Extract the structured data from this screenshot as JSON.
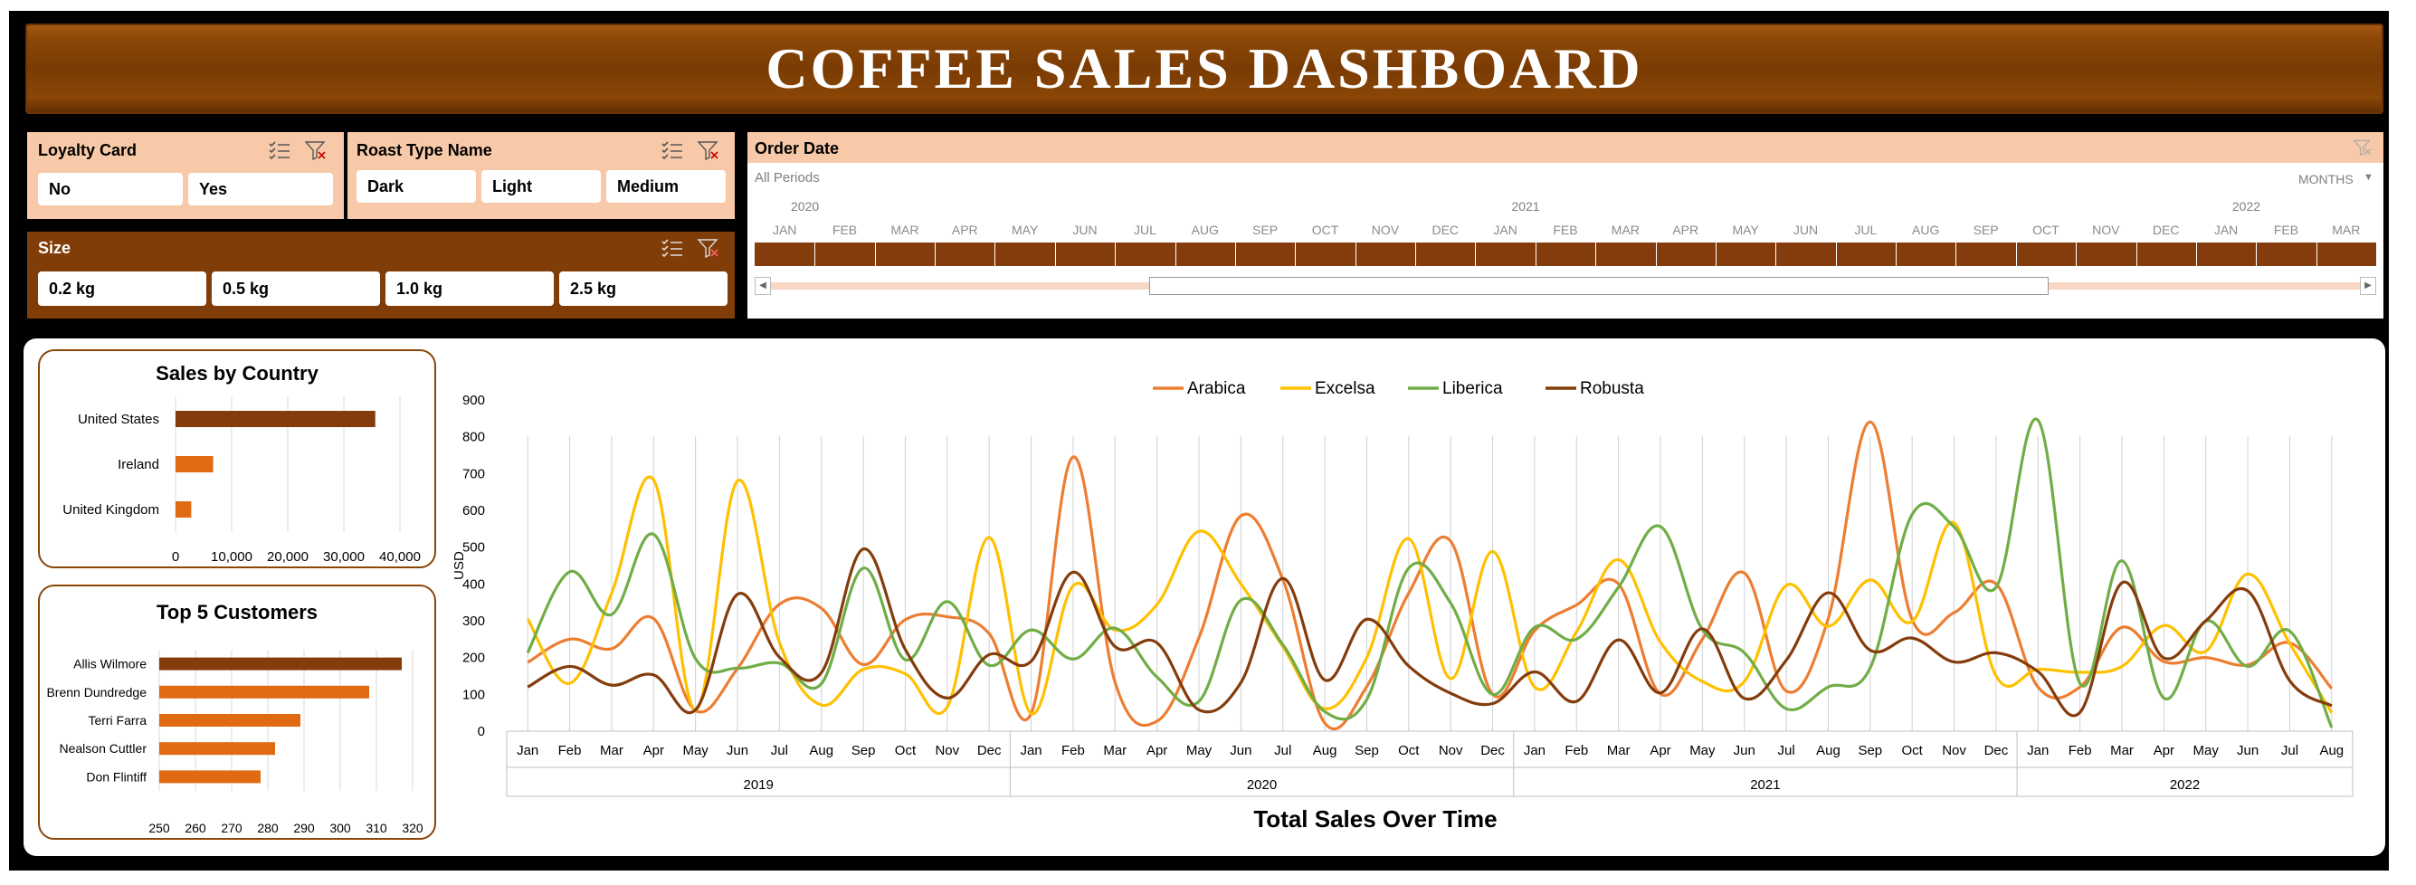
{
  "header": {
    "title": "COFFEE SALES DASHBOARD"
  },
  "slicers": {
    "loyalty": {
      "title": "Loyalty Card",
      "items": [
        "No",
        "Yes"
      ]
    },
    "roast": {
      "title": "Roast Type Name",
      "items": [
        "Dark",
        "Light",
        "Medium"
      ]
    },
    "size": {
      "title": "Size",
      "items": [
        "0.2 kg",
        "0.5 kg",
        "1.0 kg",
        "2.5 kg"
      ]
    }
  },
  "timeline": {
    "title": "Order Date",
    "period_label": "All Periods",
    "level": "MONTHS",
    "years": [
      "2020",
      "2021",
      "2022"
    ],
    "months": [
      "JAN",
      "FEB",
      "MAR",
      "APR",
      "MAY",
      "JUN",
      "JUL",
      "AUG",
      "SEP",
      "OCT",
      "NOV",
      "DEC",
      "JAN",
      "FEB",
      "MAR",
      "APR",
      "MAY",
      "JUN",
      "JUL",
      "AUG",
      "SEP",
      "OCT",
      "NOV",
      "DEC",
      "JAN",
      "FEB",
      "MAR"
    ]
  },
  "chart_data": [
    {
      "type": "bar",
      "orientation": "horizontal",
      "title": "Sales by Country",
      "categories": [
        "United States",
        "Ireland",
        "United Kingdom"
      ],
      "values": [
        35600,
        6700,
        2800
      ],
      "xlim": [
        0,
        40000
      ],
      "xticks": [
        "0",
        "10,000",
        "20,000",
        "30,000",
        "40,000"
      ],
      "colors": {
        "bar_top": "#843c0c",
        "bar": "#e06a12"
      }
    },
    {
      "type": "bar",
      "orientation": "horizontal",
      "title": "Top 5 Customers",
      "categories": [
        "Allis Wilmore",
        "Brenn Dundredge",
        "Terri Farra",
        "Nealson Cuttler",
        "Don Flintiff"
      ],
      "values": [
        317,
        308,
        289,
        282,
        278
      ],
      "xlim": [
        250,
        320
      ],
      "xticks": [
        "250",
        "260",
        "270",
        "280",
        "290",
        "300",
        "310",
        "320"
      ],
      "colors": {
        "bar_top": "#843c0c",
        "bar": "#e06a12"
      }
    },
    {
      "type": "line",
      "title": "Total Sales Over Time",
      "ylabel": "USD",
      "ylim": [
        0,
        900
      ],
      "yticks": [
        "0",
        "100",
        "200",
        "300",
        "400",
        "500",
        "600",
        "700",
        "800",
        "900"
      ],
      "x": [
        "Jan",
        "Feb",
        "Mar",
        "Apr",
        "May",
        "Jun",
        "Jul",
        "Aug",
        "Sep",
        "Oct",
        "Nov",
        "Dec",
        "Jan",
        "Feb",
        "Mar",
        "Apr",
        "May",
        "Jun",
        "Jul",
        "Aug",
        "Sep",
        "Oct",
        "Nov",
        "Dec",
        "Jan",
        "Feb",
        "Mar",
        "Apr",
        "May",
        "Jun",
        "Jul",
        "Aug",
        "Sep",
        "Oct",
        "Nov",
        "Dec",
        "Jan",
        "Feb",
        "Mar",
        "Apr",
        "May",
        "Jun",
        "Jul",
        "Aug"
      ],
      "x_groups": [
        {
          "label": "2019",
          "count": 12
        },
        {
          "label": "2020",
          "count": 12
        },
        {
          "label": "2021",
          "count": 12
        },
        {
          "label": "2022",
          "count": 8
        }
      ],
      "legend_position": "top",
      "series": [
        {
          "name": "Arabica",
          "color": "#ed7d31",
          "values": [
            187,
            250,
            224,
            306,
            56,
            170,
            345,
            334,
            181,
            303,
            311,
            265,
            48,
            745,
            133,
            27,
            254,
            585,
            412,
            22,
            121,
            375,
            516,
            100,
            273,
            343,
            400,
            101,
            250,
            430,
            109,
            306,
            840,
            303,
            322,
            400,
            120,
            120,
            282,
            189,
            200,
            180,
            240,
            116
          ]
        },
        {
          "name": "Excelsa",
          "color": "#ffc000",
          "values": [
            305,
            130,
            375,
            683,
            58,
            680,
            241,
            71,
            168,
            156,
            66,
            526,
            48,
            395,
            275,
            344,
            543,
            400,
            230,
            61,
            200,
            523,
            143,
            488,
            120,
            270,
            466,
            242,
            135,
            135,
            396,
            285,
            411,
            298,
            566,
            150,
            168,
            160,
            176,
            287,
            217,
            427,
            238,
            50
          ]
        },
        {
          "name": "Liberica",
          "color": "#70ad47",
          "values": [
            213,
            433,
            317,
            535,
            197,
            171,
            185,
            129,
            443,
            194,
            352,
            179,
            275,
            196,
            280,
            147,
            81,
            356,
            235,
            53,
            86,
            443,
            348,
            100,
            282,
            250,
            391,
            556,
            276,
            213,
            61,
            120,
            172,
            589,
            555,
            391,
            845,
            130,
            463,
            90,
            299,
            176,
            272,
            10
          ]
        },
        {
          "name": "Robusta",
          "color": "#843c0c",
          "values": [
            120,
            176,
            125,
            153,
            58,
            372,
            201,
            159,
            495,
            222,
            90,
            208,
            190,
            432,
            230,
            240,
            58,
            132,
            415,
            139,
            304,
            177,
            103,
            75,
            161,
            81,
            248,
            104,
            278,
            89,
            193,
            376,
            220,
            253,
            188,
            213,
            162,
            51,
            403,
            199,
            300,
            381,
            137,
            69
          ]
        }
      ]
    }
  ]
}
